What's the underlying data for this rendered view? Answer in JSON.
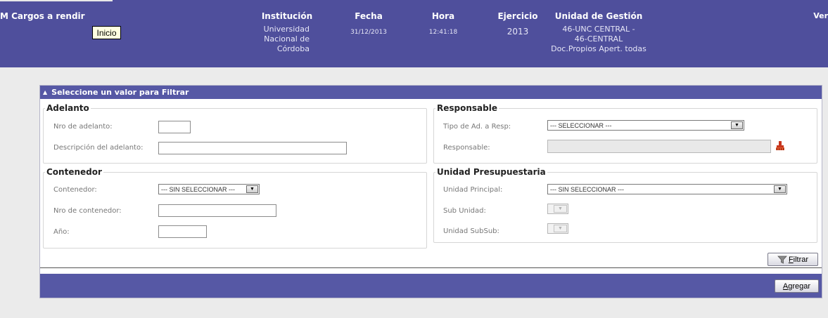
{
  "header": {
    "app_title": "M Cargos a rendir",
    "home_button": "Inicio",
    "columns": [
      {
        "heading": "Institución",
        "value": "Universidad\nNacional de\nCórdoba"
      },
      {
        "heading": "Fecha",
        "value": "31/12/2013"
      },
      {
        "heading": "Hora",
        "value": "12:41:18"
      },
      {
        "heading": "Ejercicio",
        "value": "2013"
      },
      {
        "heading": "Unidad de Gestión",
        "value": "46-UNC CENTRAL -\n46-CENTRAL\nDoc.Propios Apert. todas"
      }
    ],
    "ver_link": "Ver"
  },
  "filter_panel": {
    "title": "Seleccione un valor para Filtrar",
    "adelanto": {
      "legend": "Adelanto",
      "nro_label": "Nro de adelanto:",
      "nro_value": "",
      "desc_label": "Descripción del adelanto:",
      "desc_value": ""
    },
    "contenedor": {
      "legend": "Contenedor",
      "contenedor_label": "Contenedor:",
      "contenedor_value": "--- SIN SELECCIONAR ---",
      "nro_label": "Nro de contenedor:",
      "nro_value": "",
      "anio_label": "Año:",
      "anio_value": ""
    },
    "responsable": {
      "legend": "Responsable",
      "tipo_label": "Tipo de Ad. a Resp:",
      "tipo_value": "--- SELECCIONAR ---",
      "responsable_label": "Responsable:",
      "responsable_value": ""
    },
    "unidad": {
      "legend": "Unidad Presupuestaria",
      "principal_label": "Unidad Principal:",
      "principal_value": "--- SIN SELECCIONAR ---",
      "sub_label": "Sub Unidad:",
      "subsub_label": "Unidad SubSub:"
    },
    "filter_button": {
      "first_letter": "F",
      "rest": "iltrar"
    },
    "add_button": {
      "first_letter": "A",
      "rest": "gregar"
    }
  },
  "colors": {
    "header_bg": "#4f4f9c",
    "panel_bar": "#5658a5",
    "eraser": "#c8361e"
  },
  "icons": [
    "chevron-down-icon",
    "eraser-icon",
    "funnel-icon",
    "collapse-caret-icon"
  ]
}
